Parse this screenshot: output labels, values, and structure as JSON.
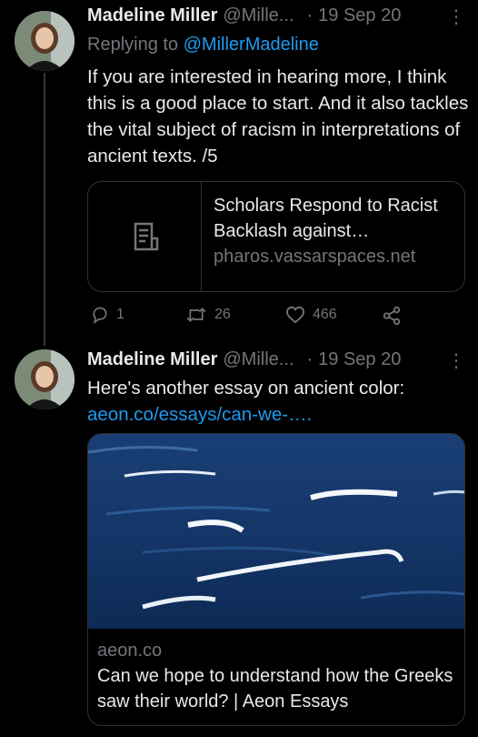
{
  "tweets": [
    {
      "name": "Madeline Miller",
      "handle": "@Mille...",
      "dot": "·",
      "date": "19 Sep 20",
      "more": "⋮",
      "reply_prefix": "Replying to",
      "reply_mention": "@MillerMadeline",
      "text": "If you are interested in hearing more, I think this is a good place to start. And it also tackles the vital subject of racism in interpretations of ancient texts.  /5",
      "card": {
        "title": "Scholars Respond to Racist Backlash against…",
        "domain": "pharos.vassarspaces.net",
        "icon": "document-icon"
      },
      "actions": {
        "replies": "1",
        "retweets": "26",
        "likes": "466"
      }
    },
    {
      "name": "Madeline Miller",
      "handle": "@Mille...",
      "dot": "·",
      "date": "19 Sep 20",
      "more": "⋮",
      "text": "Here's another essay on ancient color:",
      "link": "aeon.co/essays/can-we-….",
      "media_card": {
        "domain": "aeon.co",
        "title": "Can we hope to understand how the Greeks saw their world? | Aeon Essays"
      }
    }
  ],
  "colors": {
    "background": "#000000",
    "text": "#e7e9ea",
    "muted": "#71767b",
    "accent": "#1d9bf0",
    "border": "#2f3336"
  }
}
